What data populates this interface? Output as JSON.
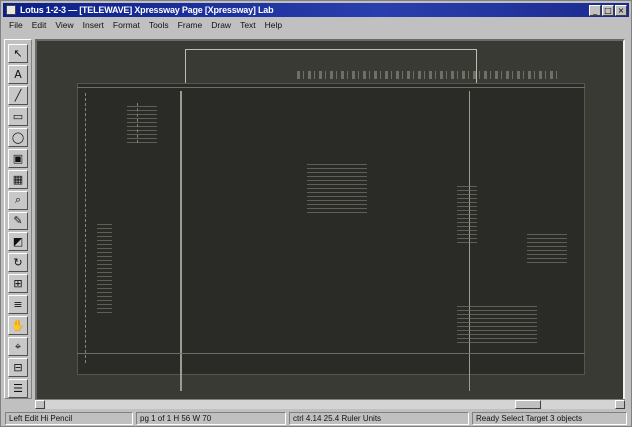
{
  "window": {
    "title": "Lotus 1-2-3 — [TELEWAVE] Xpressway Page [Xpressway] Lab",
    "controls": [
      "_",
      "□",
      "×"
    ]
  },
  "menu": [
    "File",
    "Edit",
    "View",
    "Insert",
    "Format",
    "Tools",
    "Frame",
    "Draw",
    "Text",
    "Help"
  ],
  "tools": [
    {
      "icon": "pointer-icon",
      "glyph": "↖"
    },
    {
      "icon": "text-icon",
      "glyph": "A"
    },
    {
      "icon": "line-icon",
      "glyph": "╱"
    },
    {
      "icon": "rectangle-icon",
      "glyph": "▭"
    },
    {
      "icon": "ellipse-icon",
      "glyph": "◯"
    },
    {
      "icon": "frame-icon",
      "glyph": "▣"
    },
    {
      "icon": "table-icon",
      "glyph": "▦"
    },
    {
      "icon": "zoom-icon",
      "glyph": "⌕"
    },
    {
      "icon": "pen-icon",
      "glyph": "✎"
    },
    {
      "icon": "fill-icon",
      "glyph": "◩"
    },
    {
      "icon": "rotate-icon",
      "glyph": "↻"
    },
    {
      "icon": "grid-icon",
      "glyph": "⊞"
    },
    {
      "icon": "layers-icon",
      "glyph": "≡"
    },
    {
      "icon": "hand-icon",
      "glyph": "✋"
    },
    {
      "icon": "eyedropper-icon",
      "glyph": "⌖"
    },
    {
      "icon": "ruler-icon",
      "glyph": "⊟"
    },
    {
      "icon": "properties-icon",
      "glyph": "☰"
    }
  ],
  "status": {
    "cell1": "Left Edit Hi Pencil",
    "cell2": "pg 1 of 1 H 56 W 70",
    "cell3": "ctrl 4.14 25.4 Ruler Units",
    "cell4": "Ready Select Target 3 objects"
  }
}
